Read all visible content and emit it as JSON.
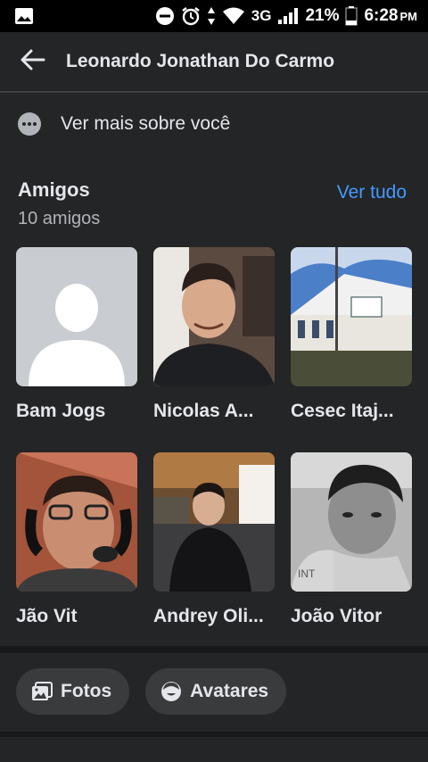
{
  "status_bar": {
    "network": "3G",
    "battery": "21%",
    "time": "6:28",
    "ampm": "PM"
  },
  "header": {
    "title": "Leonardo Jonathan Do Carmo"
  },
  "about": {
    "label": "Ver mais sobre você"
  },
  "friends": {
    "title": "Amigos",
    "count_text": "10 amigos",
    "see_all": "Ver tudo",
    "items": [
      {
        "name": "Bam Jogs"
      },
      {
        "name": "Nicolas A..."
      },
      {
        "name": "Cesec Itaj..."
      },
      {
        "name": "Jão Vit"
      },
      {
        "name": "Andrey Oli..."
      },
      {
        "name": "João Vitor"
      }
    ]
  },
  "chips": {
    "photos": "Fotos",
    "avatars": "Avatares"
  },
  "colors": {
    "background": "#242526",
    "accent": "#4599ff",
    "chip": "#3a3b3c"
  }
}
